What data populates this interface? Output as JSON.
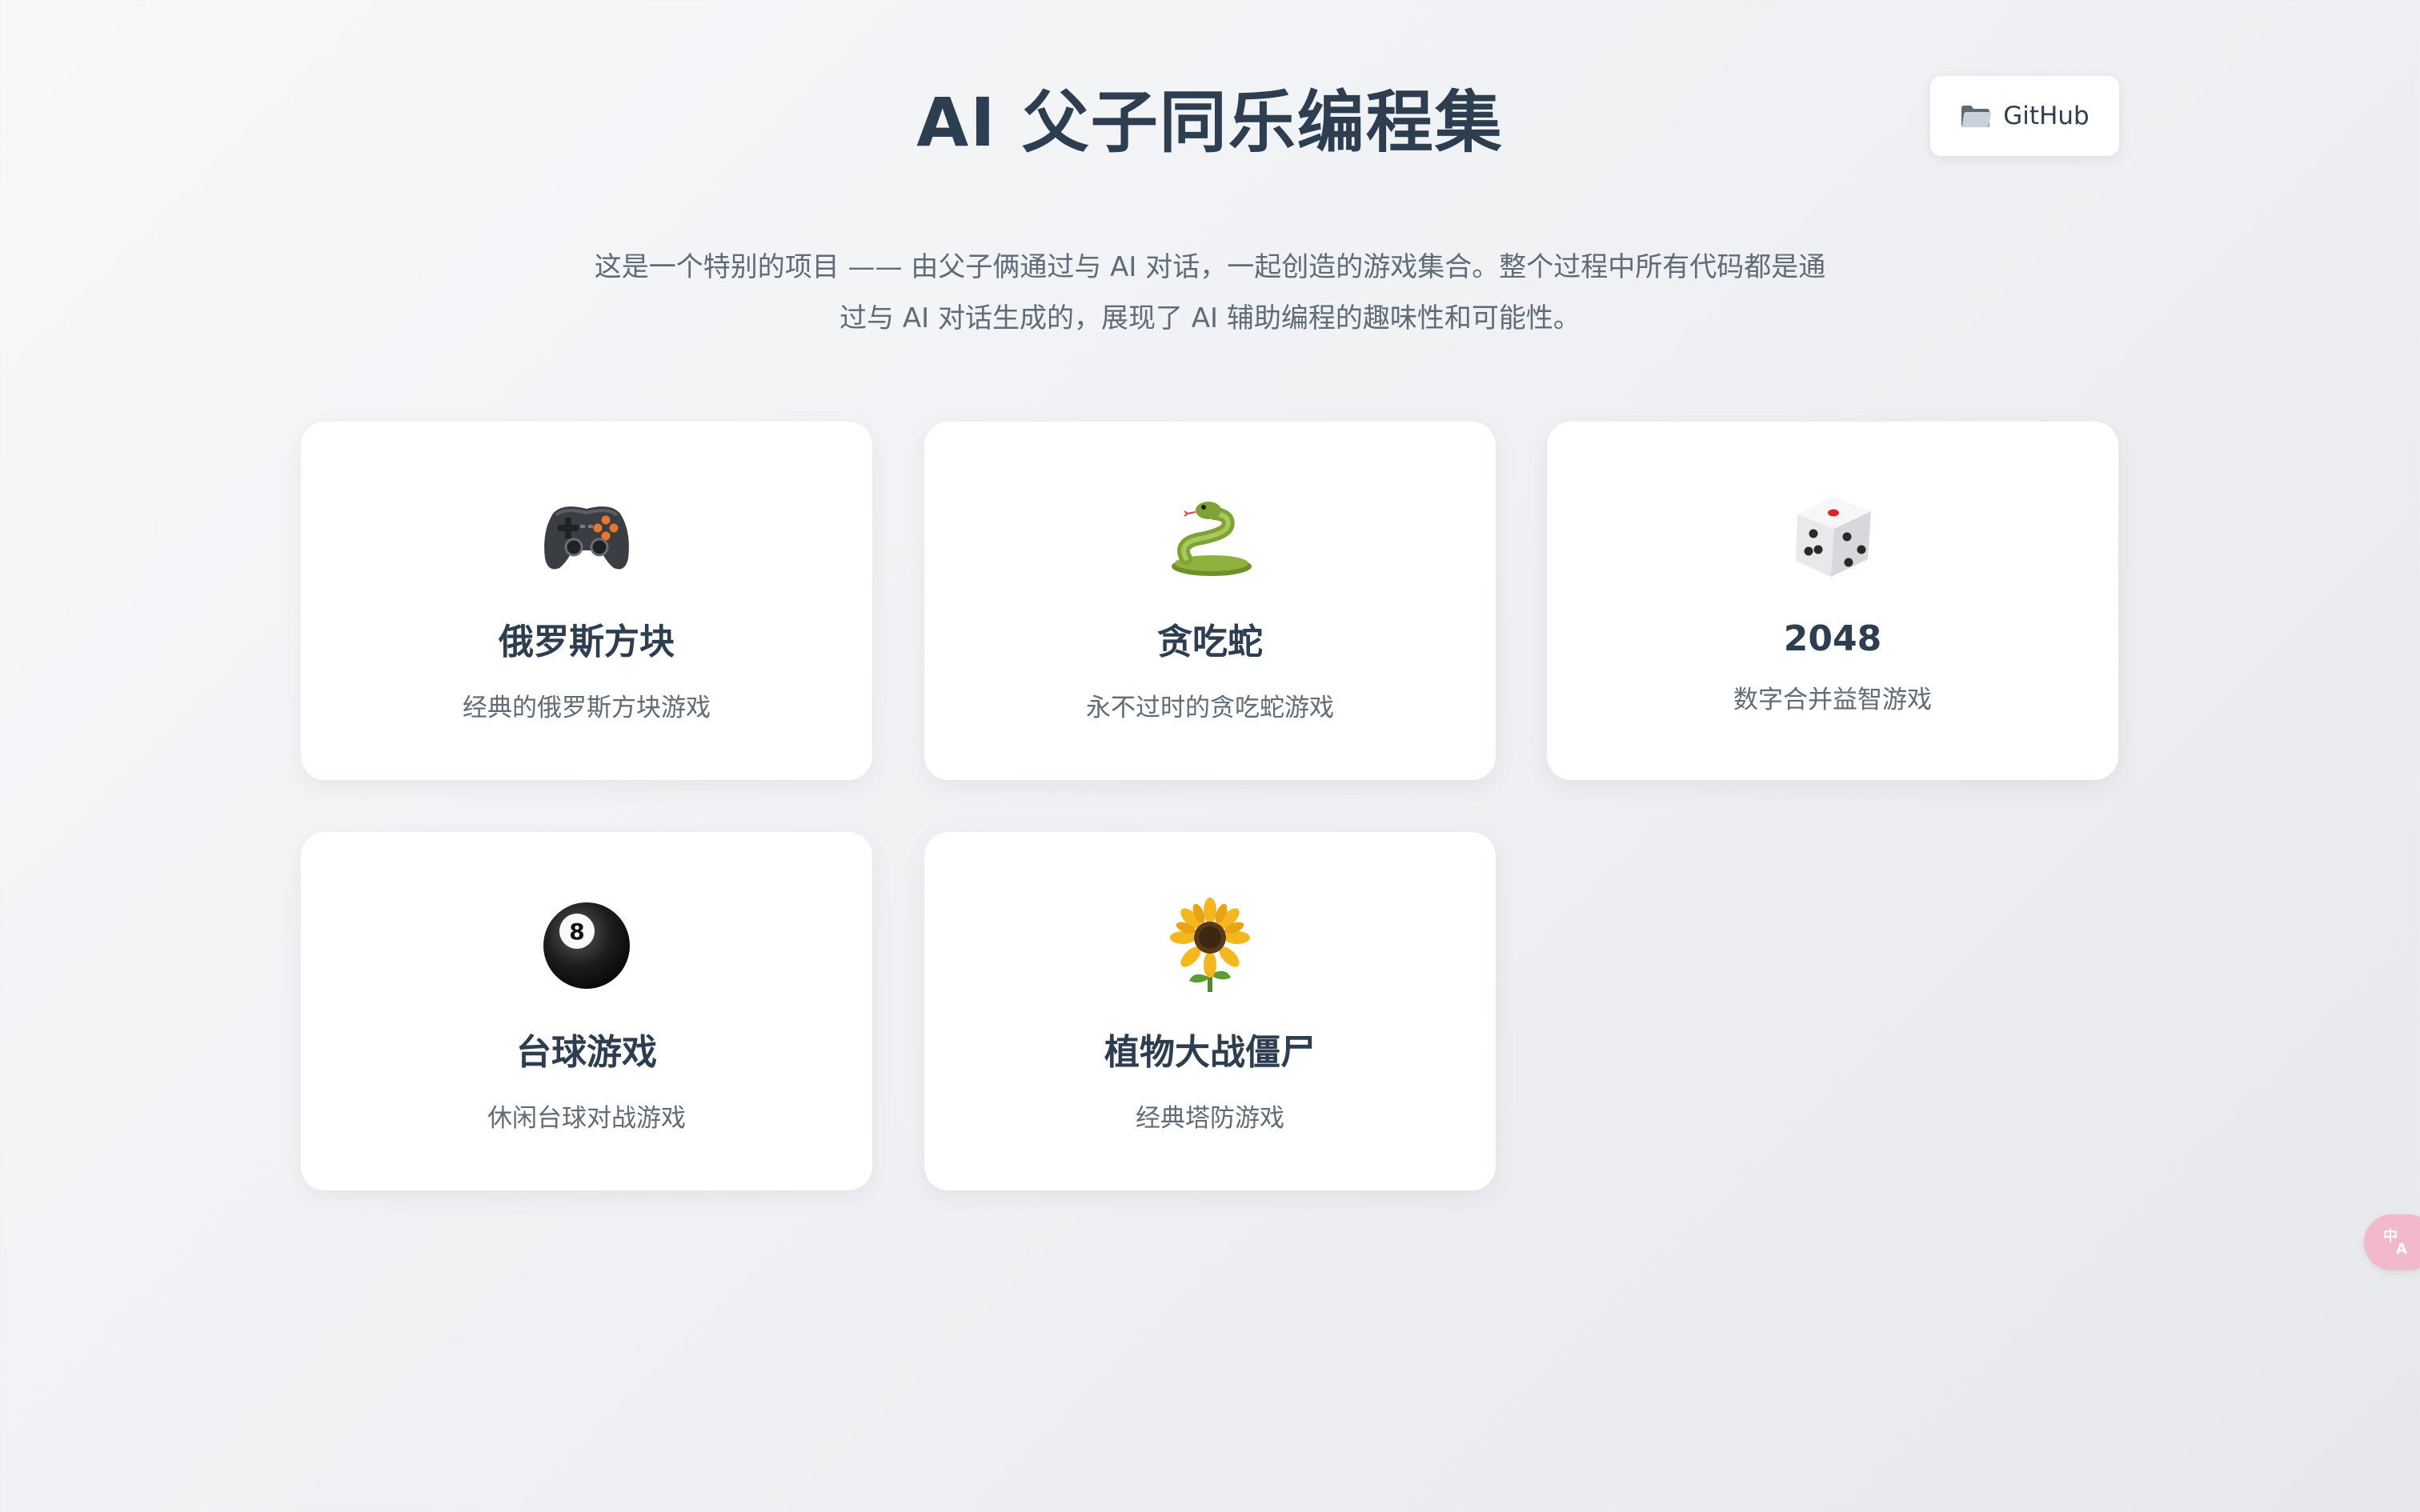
{
  "header": {
    "title": "AI 父子同乐编程集",
    "github_label": "GitHub",
    "github_icon": "folder-icon"
  },
  "intro": {
    "line1": "这是一个特别的项目 —— 由父子俩通过与 AI 对话，一起创造的游戏集合。整个过程中所有代码都是通",
    "line2": "过与 AI 对话生成的，展现了 AI 辅助编程的趣味性和可能性。"
  },
  "games": [
    {
      "icon": "gamepad-icon",
      "title": "俄罗斯方块",
      "description": "经典的俄罗斯方块游戏"
    },
    {
      "icon": "snake-icon",
      "title": "贪吃蛇",
      "description": "永不过时的贪吃蛇游戏"
    },
    {
      "icon": "dice-icon",
      "title": "2048",
      "description": "数字合并益智游戏"
    },
    {
      "icon": "billiard-ball-icon",
      "title": "台球游戏",
      "description": "休闲台球对战游戏"
    },
    {
      "icon": "sunflower-icon",
      "title": "植物大战僵尸",
      "description": "经典塔防游戏"
    }
  ],
  "floating": {
    "translate_icon": "translate-icon"
  }
}
